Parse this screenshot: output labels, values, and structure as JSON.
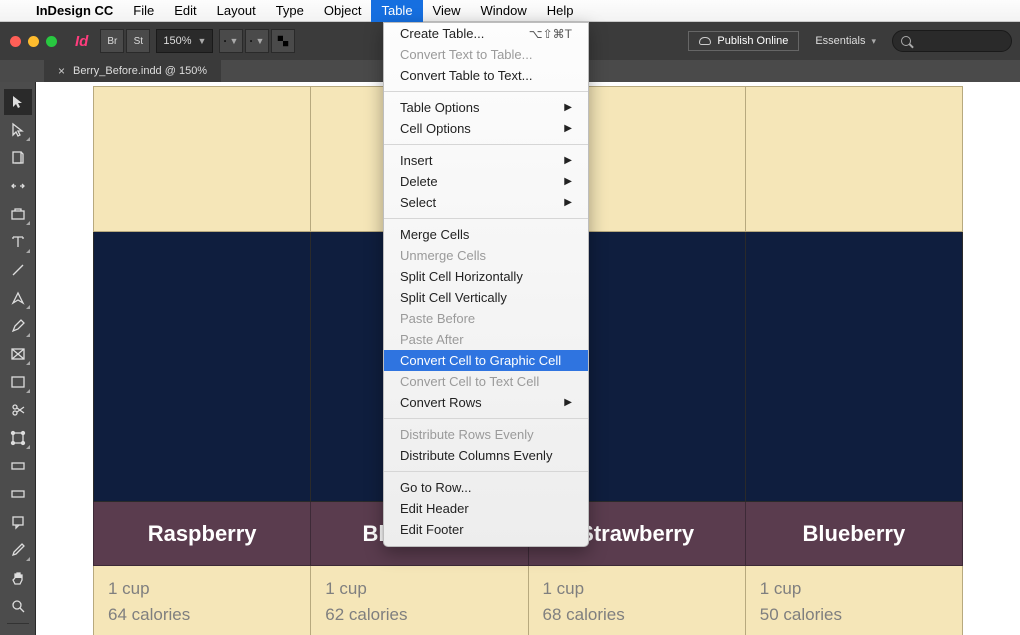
{
  "menubar": {
    "app_name": "InDesign CC",
    "items": [
      "File",
      "Edit",
      "Layout",
      "Type",
      "Object",
      "Table",
      "View",
      "Window",
      "Help"
    ],
    "active_index": 5
  },
  "toolbar": {
    "br_label": "Br",
    "st_label": "St",
    "zoom": "150%",
    "publish_label": "Publish Online",
    "workspace": "Essentials"
  },
  "tab": {
    "label": "Berry_Before.indd @ 150%"
  },
  "dropdown": {
    "groups": [
      [
        {
          "label": "Create Table...",
          "shortcut": "⌥⇧⌘T"
        },
        {
          "label": "Convert Text to Table...",
          "disabled": true
        },
        {
          "label": "Convert Table to Text..."
        }
      ],
      [
        {
          "label": "Table Options",
          "submenu": true
        },
        {
          "label": "Cell Options",
          "submenu": true
        }
      ],
      [
        {
          "label": "Insert",
          "submenu": true
        },
        {
          "label": "Delete",
          "submenu": true
        },
        {
          "label": "Select",
          "submenu": true
        }
      ],
      [
        {
          "label": "Merge Cells"
        },
        {
          "label": "Unmerge Cells",
          "disabled": true
        },
        {
          "label": "Split Cell Horizontally"
        },
        {
          "label": "Split Cell Vertically"
        },
        {
          "label": "Paste Before",
          "disabled": true
        },
        {
          "label": "Paste After",
          "disabled": true
        },
        {
          "label": "Convert Cell to Graphic Cell",
          "highlight": true
        },
        {
          "label": "Convert Cell to Text Cell",
          "disabled": true
        },
        {
          "label": "Convert Rows",
          "submenu": true
        }
      ],
      [
        {
          "label": "Distribute Rows Evenly",
          "disabled": true
        },
        {
          "label": "Distribute Columns Evenly"
        }
      ],
      [
        {
          "label": "Go to Row..."
        },
        {
          "label": "Edit Header"
        },
        {
          "label": "Edit Footer"
        }
      ]
    ]
  },
  "table_data": {
    "headers": [
      "Raspberry",
      "Blackberry",
      "Strawberry",
      "Blueberry"
    ],
    "rows": [
      {
        "serving": "1 cup",
        "calories": "64 calories"
      },
      {
        "serving": "1 cup",
        "calories": "62 calories"
      },
      {
        "serving": "1 cup",
        "calories": "68 calories"
      },
      {
        "serving": "1 cup",
        "calories": "50 calories"
      }
    ]
  }
}
